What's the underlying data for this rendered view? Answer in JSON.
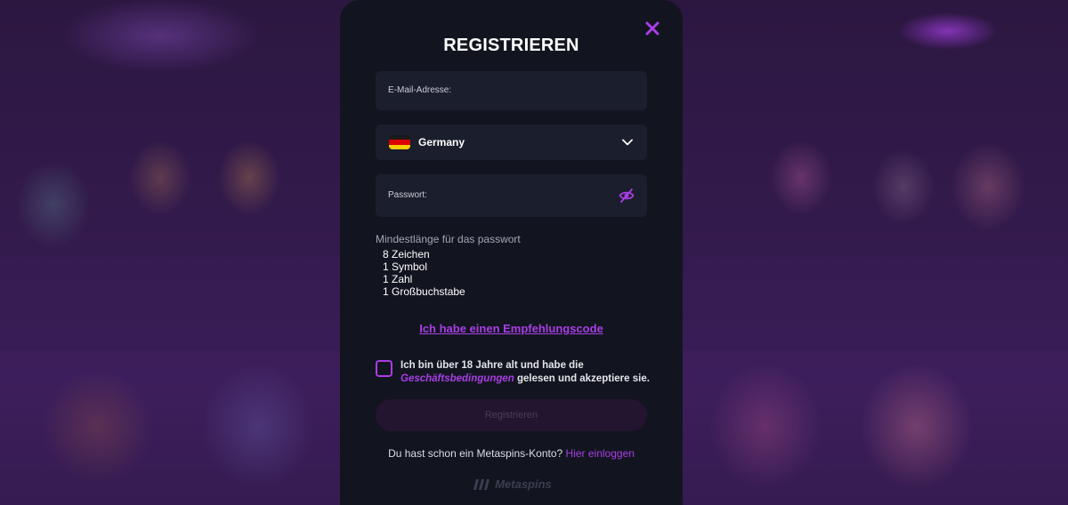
{
  "modal": {
    "title": "REGISTRIEREN",
    "email_label": "E-Mail-Adresse:",
    "country": {
      "selected": "Germany",
      "flag_colors": [
        "#1a1a1a",
        "#dd0000",
        "#ffce00"
      ]
    },
    "password_label": "Passwort:",
    "requirements_title": "Mindestlänge für das passwort",
    "requirements": [
      "8 Zeichen",
      "1 Symbol",
      "1 Zahl",
      "1 Großbuchstabe"
    ],
    "referral_link": "Ich habe einen Empfehlungscode",
    "terms": {
      "prefix": "Ich bin über 18 Jahre alt und habe die",
      "link": "Geschäftsbedingungen",
      "suffix": " gelesen und akzeptiere sie."
    },
    "submit_label": "Registrieren",
    "login_prompt": "Du hast schon ein Metaspins-Konto?",
    "login_link": "Hier einloggen",
    "brand": "Metaspins"
  },
  "colors": {
    "accent": "#a93ee6",
    "modal_bg": "#121520",
    "field_bg": "#1b1e2c"
  },
  "icons": {
    "close": "close-icon",
    "dropdown": "chevron-down-icon",
    "password_toggle": "eye-off-icon",
    "brand_logo": "metaspins-logo-icon"
  }
}
